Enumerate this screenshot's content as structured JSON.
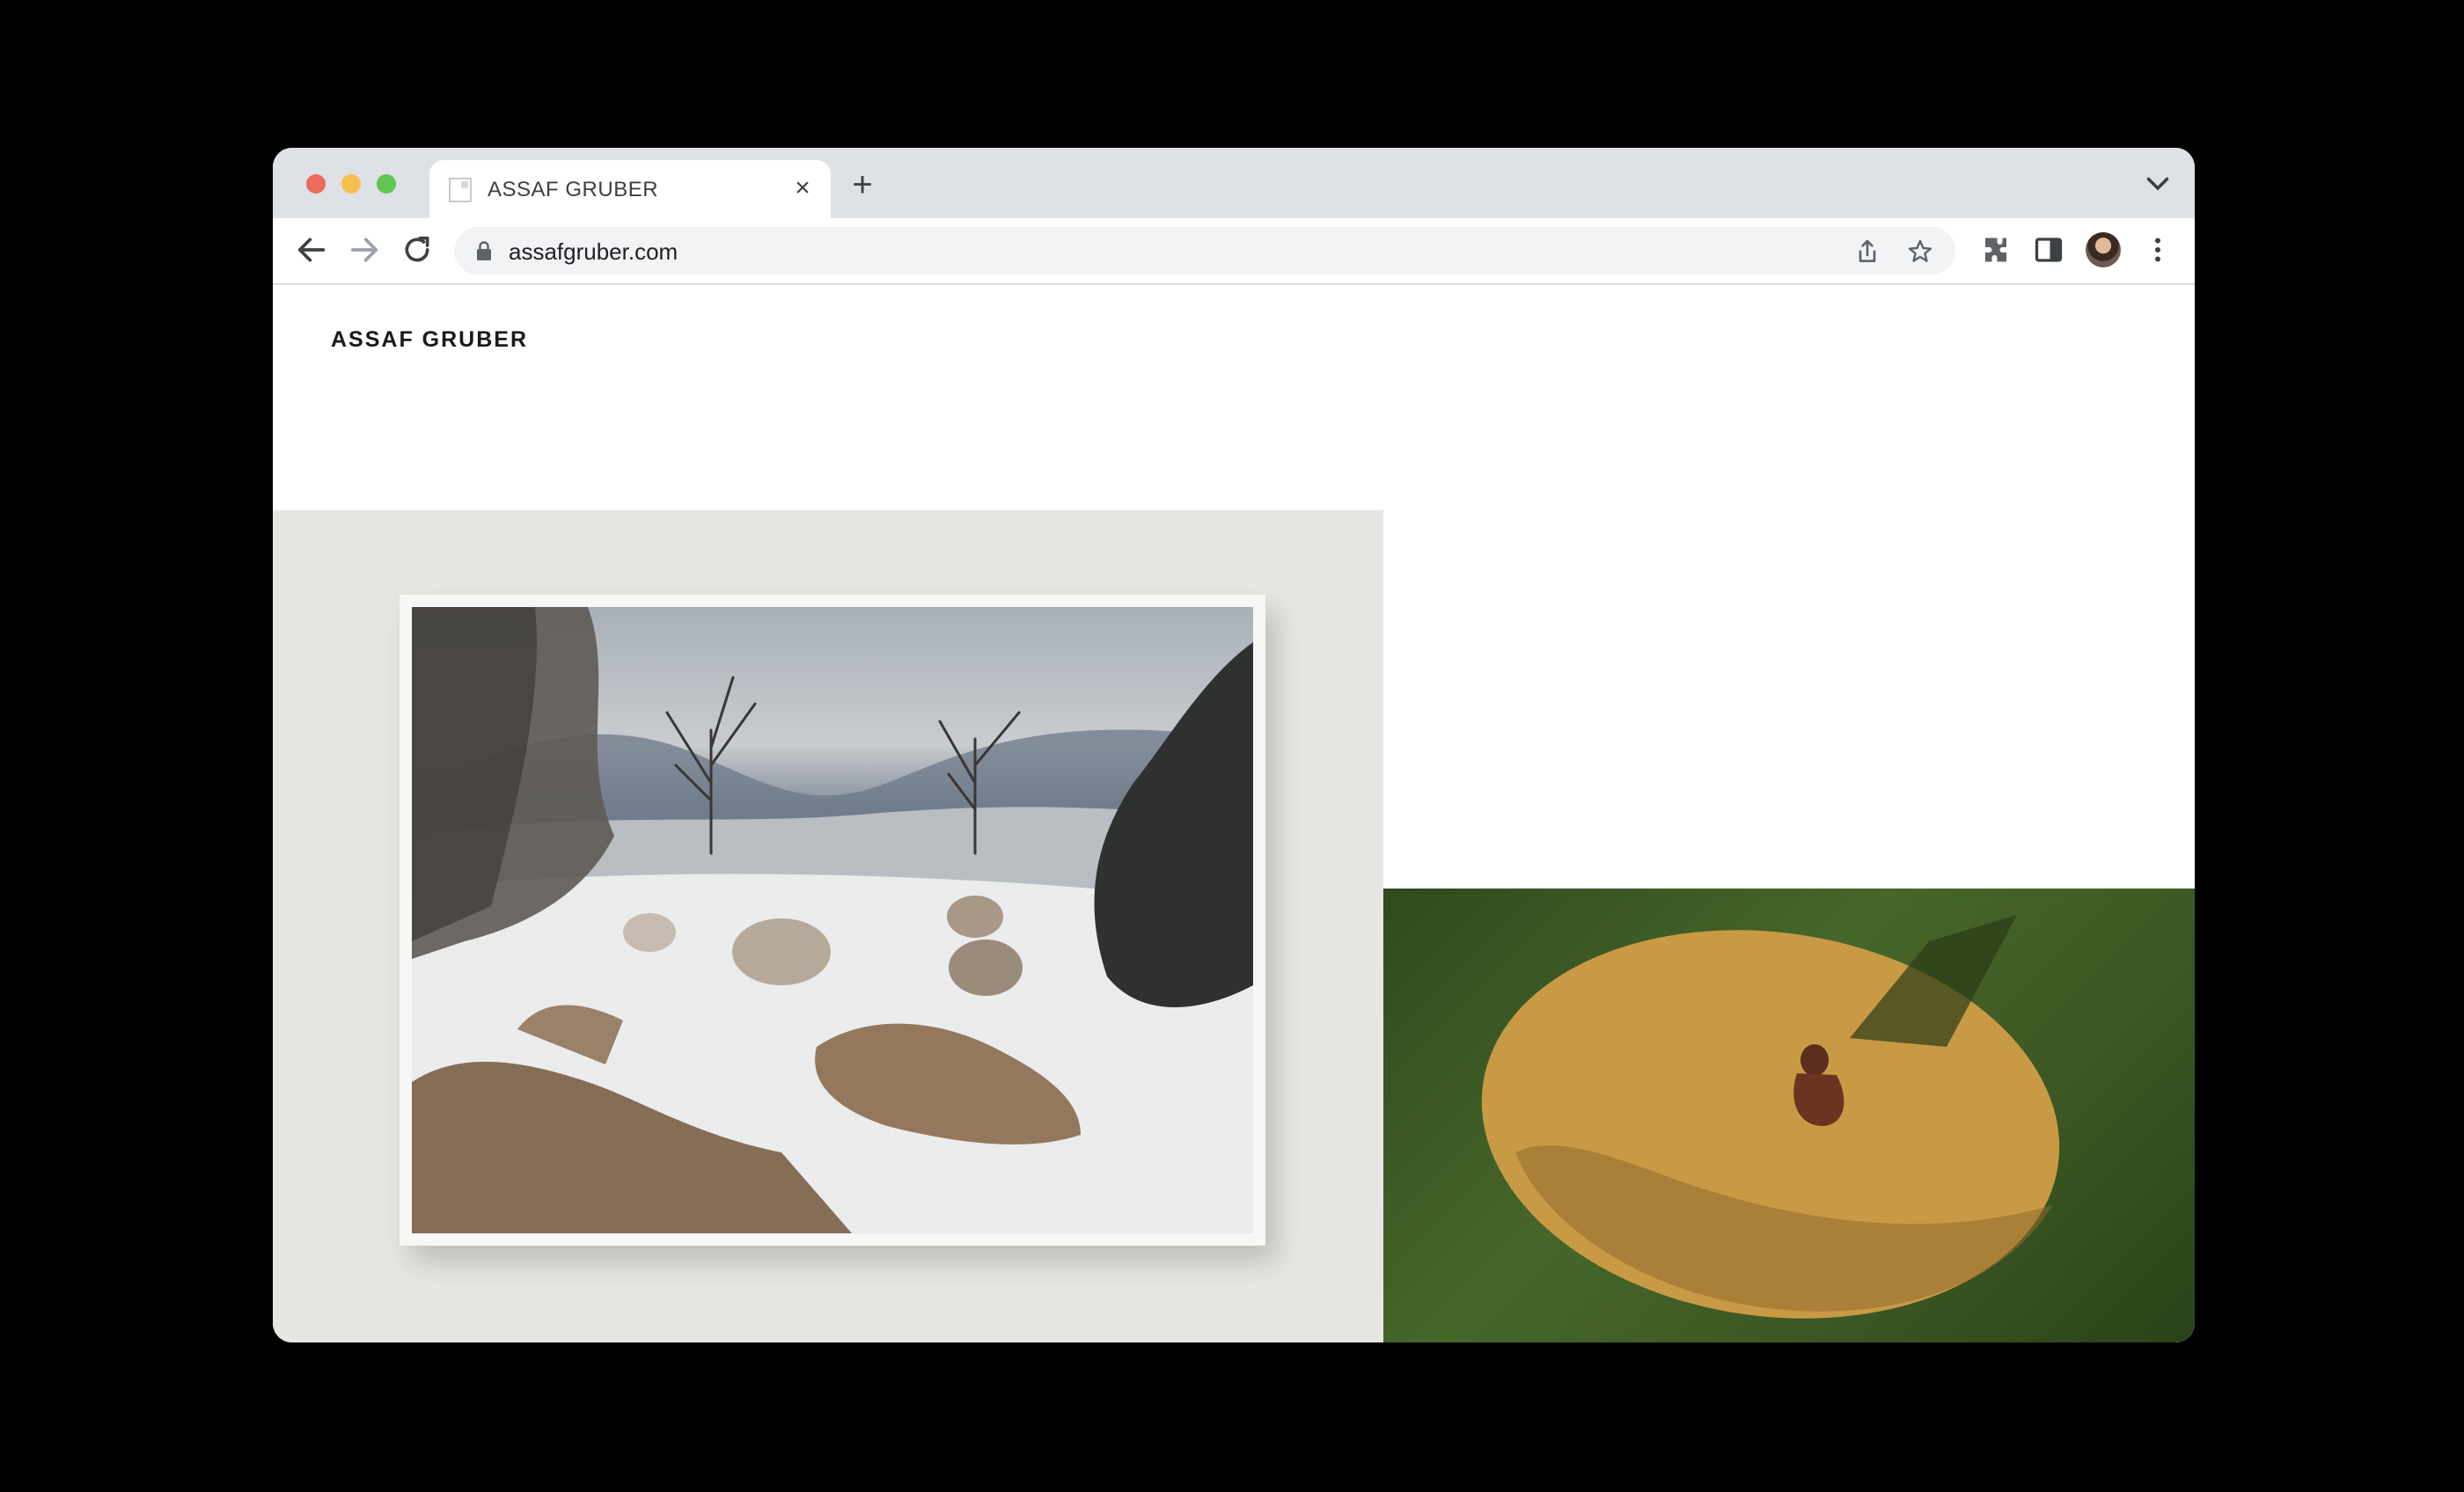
{
  "browser": {
    "tab": {
      "title": "ASSAF GRUBER"
    },
    "address_bar": {
      "url": "assafgruber.com"
    }
  },
  "site": {
    "title": "ASSAF GRUBER"
  },
  "colors": {
    "tabstrip": "#dee1e6",
    "omnibox": "#f1f3f4",
    "gallery_wall": "#e7e6e2",
    "grass": "#46662a",
    "sand": "#c99a45"
  }
}
